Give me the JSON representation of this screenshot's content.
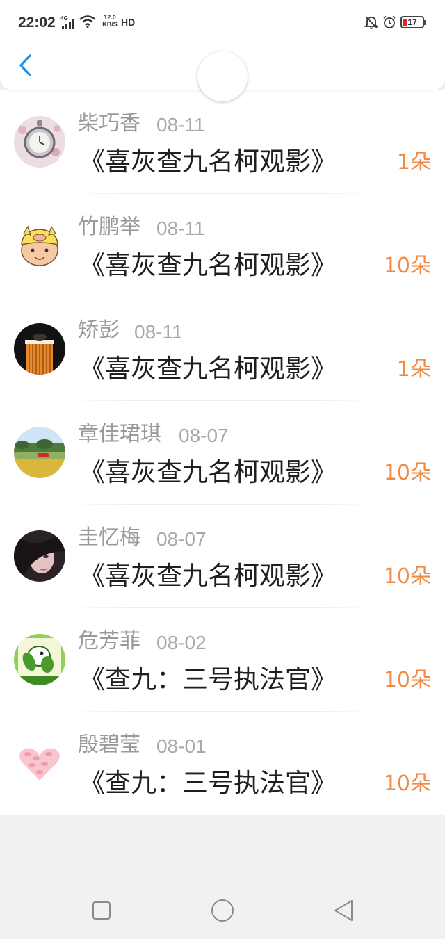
{
  "status_bar": {
    "time": "22:02",
    "network": "4G",
    "speed_value": "12.0",
    "speed_unit": "KB/S",
    "hd": "HD",
    "battery": "17",
    "battery_level": 0.17
  },
  "header": {
    "back_icon": "chevron-left-icon"
  },
  "records": [
    {
      "name": "柴巧香",
      "date": "08-11",
      "movie": "《喜灰查九名柯观影》",
      "gift": "1朵"
    },
    {
      "name": "竹鹏举",
      "date": "08-11",
      "movie": "《喜灰查九名柯观影》",
      "gift": "10朵"
    },
    {
      "name": "矫彭",
      "date": "08-11",
      "movie": "《喜灰查九名柯观影》",
      "gift": "1朵"
    },
    {
      "name": "章佳珺琪",
      "date": "08-07",
      "movie": "《喜灰查九名柯观影》",
      "gift": "10朵"
    },
    {
      "name": "圭忆梅",
      "date": "08-07",
      "movie": "《喜灰查九名柯观影》",
      "gift": "10朵"
    },
    {
      "name": "危芳菲",
      "date": "08-02",
      "movie": "《查九：三号执法官》",
      "gift": "10朵"
    },
    {
      "name": "殷碧莹",
      "date": "08-01",
      "movie": "《查九：三号执法官》",
      "gift": "10朵"
    }
  ],
  "nav": {
    "recent": "square-icon",
    "home": "circle-icon",
    "back": "triangle-back-icon"
  },
  "colors": {
    "accent": "#1e8fe6",
    "gift": "#ef8a45",
    "name": "#9a9a9a",
    "title": "#1f1f1f"
  }
}
